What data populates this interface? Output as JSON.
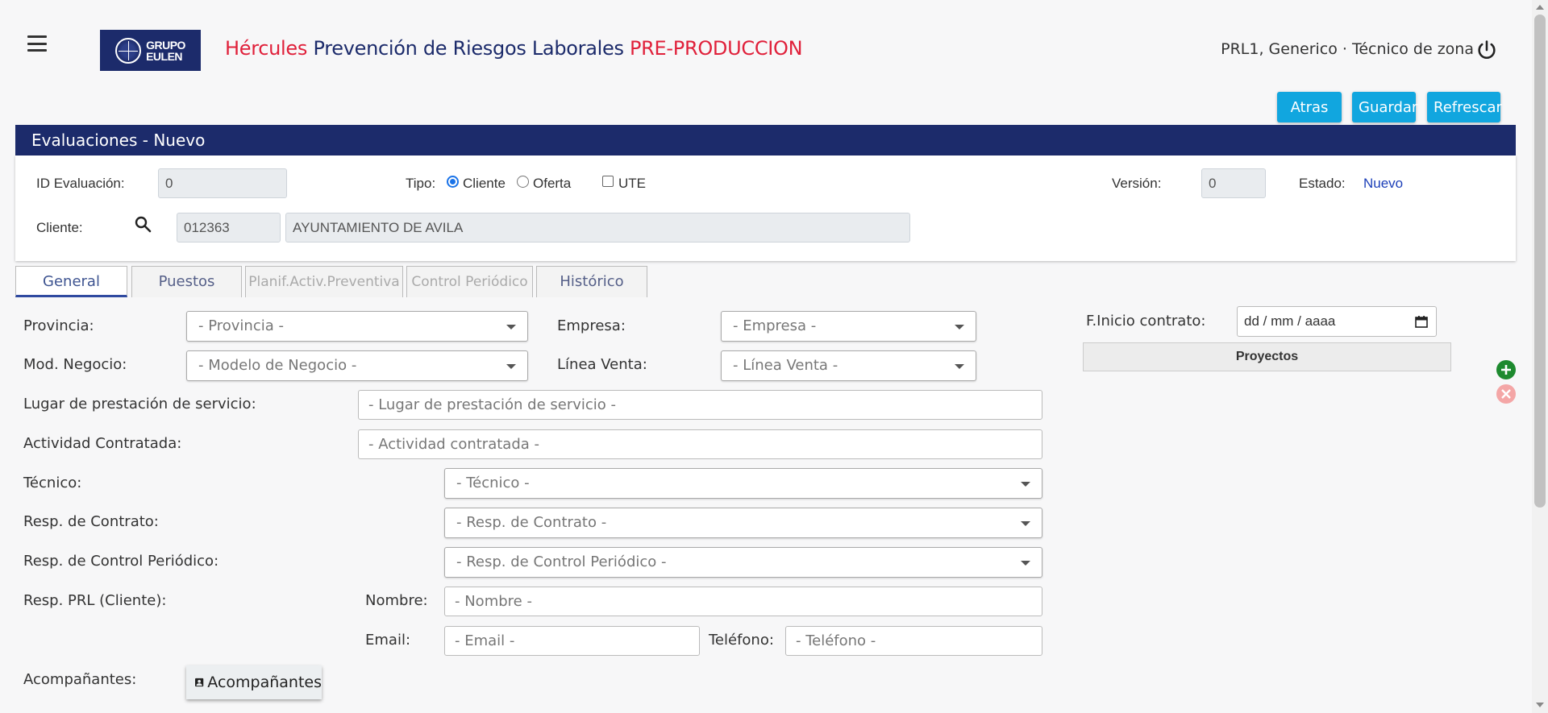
{
  "header": {
    "logo_text_1": "GRUPO",
    "logo_text_2": "EULEN",
    "app_name": "Hércules",
    "app_subtitle": " Prevención de Riesgos Laborales ",
    "env": "PRE-PRODUCCION",
    "user": "PRL1, Generico · Técnico de zona"
  },
  "toolbar": {
    "atras": "Atras",
    "guardar": "Guardar",
    "refrescar": "Refrescar"
  },
  "panel": {
    "title": "Evaluaciones - Nuevo",
    "id_label": "ID Evaluación:",
    "id_value": "0",
    "tipo_label": "Tipo:",
    "tipo_options": [
      "Cliente",
      "Oferta"
    ],
    "tipo_selected": "Cliente",
    "ute_label": "UTE",
    "version_label": "Versión:",
    "version_value": "0",
    "estado_label": "Estado:",
    "estado_value": "Nuevo",
    "cliente_label": "Cliente:",
    "cliente_code": "012363",
    "cliente_name": "AYUNTAMIENTO DE AVILA"
  },
  "tabs": [
    {
      "label": "General",
      "state": "active"
    },
    {
      "label": "Puestos",
      "state": "enabled"
    },
    {
      "label": "Planif.Activ.Preventiva",
      "state": "disabled"
    },
    {
      "label": "Control Periódico",
      "state": "disabled"
    },
    {
      "label": "Histórico",
      "state": "enabled"
    }
  ],
  "form": {
    "provincia_label": "Provincia:",
    "provincia_ph": "- Provincia -",
    "empresa_label": "Empresa:",
    "empresa_ph": "- Empresa -",
    "mod_negocio_label": "Mod. Negocio:",
    "mod_negocio_ph": "- Modelo de Negocio -",
    "linea_venta_label": "Línea Venta:",
    "linea_venta_ph": "- Línea Venta -",
    "lugar_label": "Lugar de prestación de servicio:",
    "lugar_ph": "- Lugar de prestación de servicio -",
    "actividad_label": "Actividad Contratada:",
    "actividad_ph": "- Actividad contratada -",
    "tecnico_label": "Técnico:",
    "tecnico_ph": "- Técnico -",
    "resp_contrato_label": "Resp. de Contrato:",
    "resp_contrato_ph": "- Resp. de Contrato -",
    "resp_control_label": "Resp. de Control Periódico:",
    "resp_control_ph": "- Resp. de Control Periódico -",
    "resp_prl_label": "Resp. PRL (Cliente):",
    "nombre_label": "Nombre:",
    "nombre_ph": "- Nombre -",
    "email_label": "Email:",
    "email_ph": "- Email -",
    "telefono_label": "Teléfono:",
    "telefono_ph": "- Teléfono -",
    "acomp_label": "Acompañantes:",
    "acomp_button": "Acompañantes",
    "finicio_label": "F.Inicio contrato:",
    "finicio_ph": "dd / mm / aaaa",
    "proyectos_header": "Proyectos"
  },
  "colors": {
    "navy": "#1c2b6b",
    "accent": "#11a6df",
    "env_red": "#e0203a",
    "estado_blue": "#1c3fb8",
    "add_green": "#1e8a2f",
    "remove_pink": "#f4a6a6"
  },
  "icons": [
    "menu-icon",
    "power-icon",
    "search-icon",
    "calendar-icon",
    "add-circle-icon",
    "remove-circle-icon",
    "person-icon"
  ]
}
